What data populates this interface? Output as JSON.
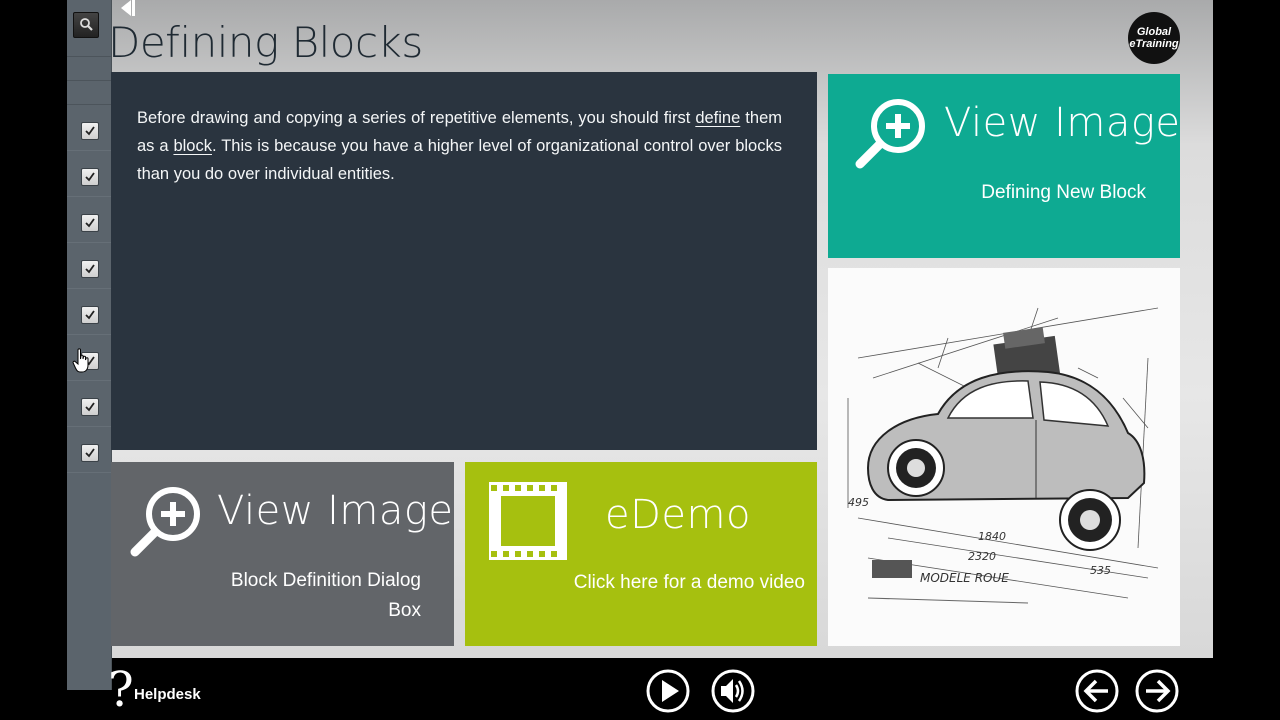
{
  "page": {
    "title": "Defining Blocks",
    "logo_line1": "Global",
    "logo_line2": "eTraining"
  },
  "content": {
    "paragraph_part1": "Before drawing and copying a series of repetitive elements, you should first ",
    "link_define": "define",
    "paragraph_part2": " them as a ",
    "link_block": "block",
    "paragraph_part3": ". This is because you have a higher level of organizational control over blocks than you do over individual entities."
  },
  "tiles": {
    "teal": {
      "title": "View Image",
      "subtitle": "Defining New Block",
      "color": "#0eaa92"
    },
    "gray": {
      "title": "View Image",
      "subtitle_line1": "Block Definition Dialog",
      "subtitle_line2": "Box",
      "color": "#626569"
    },
    "green": {
      "title": "eDemo",
      "subtitle": "Click here for a demo video",
      "color": "#a6c00f"
    }
  },
  "sidebar": {
    "checkbox_count": 8,
    "checked": [
      true,
      true,
      true,
      true,
      true,
      true,
      true,
      true
    ]
  },
  "image_text": {
    "sketch_label": "MODELE ROUE",
    "dim_1": "1840",
    "dim_2": "2320",
    "dim_3": "495",
    "dim_4": "535"
  },
  "footer": {
    "help_mark": "?",
    "helpdesk_label": "Helpdesk"
  }
}
